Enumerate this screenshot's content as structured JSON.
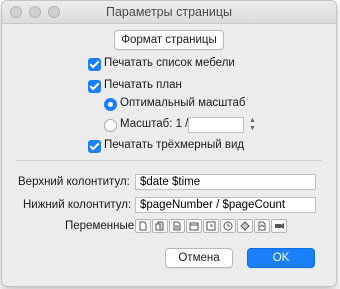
{
  "window": {
    "title": "Параметры страницы"
  },
  "page_format_button": "Формат страницы",
  "options": {
    "print_furniture_list": "Печатать список мебели",
    "print_plan": "Печатать план",
    "optimal_scale": "Оптимальный масштаб",
    "scale_label": "Масштаб: 1 /",
    "scale_value": "",
    "print_3d_view": "Печатать трёхмерный вид"
  },
  "header": {
    "label": "Верхний колонтитул:",
    "value": "$date $time"
  },
  "footer": {
    "label": "Нижний колонтитул:",
    "value": "$pageNumber / $pageCount"
  },
  "variables": {
    "label": "Переменные:",
    "icons": [
      "page-number-icon",
      "page-count-icon",
      "plan-name-icon",
      "date-icon",
      "time-icon",
      "level-icon",
      "furniture-icon",
      "camera-icon"
    ]
  },
  "buttons": {
    "cancel": "Отмена",
    "ok": "OK"
  },
  "colors": {
    "accent": "#1a7ff9",
    "window_bg": "#ececec"
  }
}
